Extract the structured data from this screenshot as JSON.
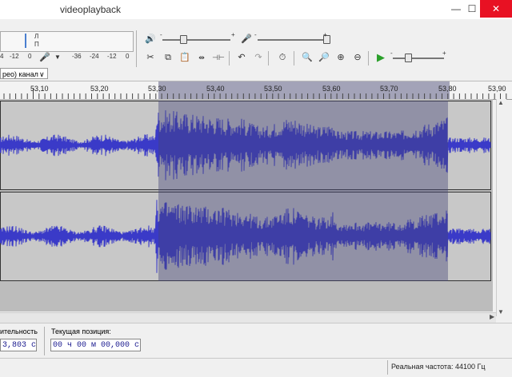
{
  "window": {
    "title": "videoplayback",
    "minimize": "—",
    "maximize": "☐",
    "close": "✕"
  },
  "meter": {
    "left_labels": [
      "-12",
      "0"
    ],
    "right_labels": [
      "-36",
      "-24",
      "-12",
      "0"
    ],
    "channel_l": "Л",
    "channel_p": "П"
  },
  "track": {
    "name": "рео) канал",
    "menu_arrow": "∨"
  },
  "ruler": {
    "labels": [
      "53,10",
      "53,20",
      "53,30",
      "53,40",
      "53,50",
      "53,60",
      "53,70",
      "53,80",
      "53,90"
    ]
  },
  "selection_toolbar": {
    "length_label": "ительность",
    "length_value": "3,803 с",
    "position_label": "Текущая позиция:",
    "position_value": "00 ч 00 м 00,000 с"
  },
  "status": {
    "rate": "Реальная частота: 44100 Гц"
  },
  "colors": {
    "waveform": "#3a3ac8",
    "selection": "#5a5a8a",
    "background": "#f0f0f0"
  },
  "icons": [
    "speaker-icon",
    "microphone-icon",
    "cut-icon",
    "copy-icon",
    "paste-icon",
    "trim-icon",
    "silence-icon",
    "undo-icon",
    "redo-icon",
    "sync-lock-icon",
    "zoom-in-icon",
    "zoom-out-icon",
    "fit-selection-icon",
    "fit-project-icon",
    "play-icon"
  ]
}
